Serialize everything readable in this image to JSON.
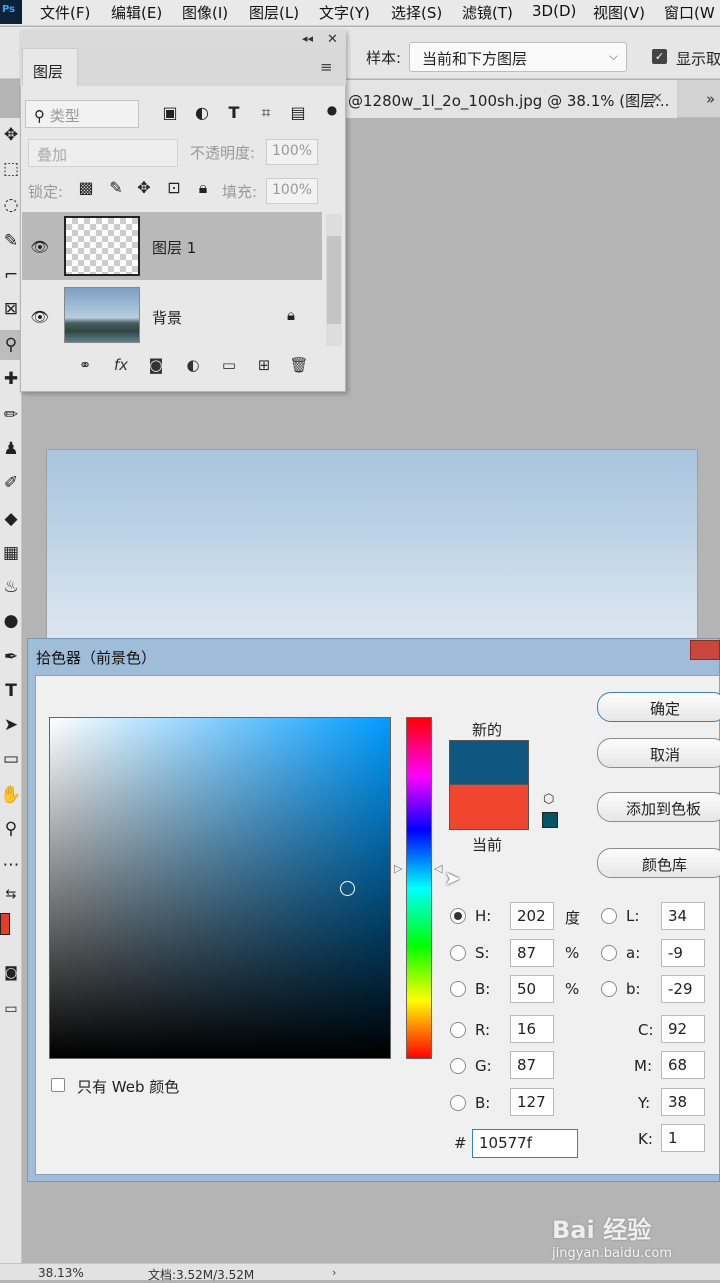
{
  "menubar": {
    "logo": "Ps",
    "items": [
      "文件(F)",
      "编辑(E)",
      "图像(I)",
      "图层(L)",
      "文字(Y)",
      "选择(S)",
      "滤镜(T)",
      "3D(D)",
      "视图(V)",
      "窗口(W"
    ]
  },
  "options": {
    "sample_label": "样本:",
    "sample_value": "当前和下方图层",
    "show_ring_label": "显示取"
  },
  "document": {
    "tab_title": "@1280w_1l_2o_100sh.jpg @ 38.1% (图层...",
    "tab_close": "×",
    "tab_more": "»"
  },
  "layers_panel": {
    "tab": "图层",
    "filter_label": "类型",
    "blend_mode": "叠加",
    "opacity_label": "不透明度:",
    "opacity_value": "100%",
    "lock_label": "锁定:",
    "fill_label": "填充:",
    "fill_value": "100%",
    "layers": [
      {
        "name": "图层 1",
        "visible": true,
        "selected": true
      },
      {
        "name": "背景",
        "visible": true,
        "locked": true
      }
    ]
  },
  "color_picker": {
    "title": "拾色器（前景色）",
    "new_label": "新的",
    "current_label": "当前",
    "new_color": "#10577f",
    "current_color": "#f0452e",
    "buttons": {
      "ok": "确定",
      "cancel": "取消",
      "add_to_swatches": "添加到色板",
      "color_libraries": "颜色库"
    },
    "web_only_label": "只有 Web 颜色",
    "hsb": {
      "h": {
        "label": "H:",
        "value": "202",
        "unit": "度"
      },
      "s": {
        "label": "S:",
        "value": "87",
        "unit": "%"
      },
      "b": {
        "label": "B:",
        "value": "50",
        "unit": "%"
      }
    },
    "lab": {
      "l": {
        "label": "L:",
        "value": "34"
      },
      "a": {
        "label": "a:",
        "value": "-9"
      },
      "b": {
        "label": "b:",
        "value": "-29"
      }
    },
    "rgb": {
      "r": {
        "label": "R:",
        "value": "16"
      },
      "g": {
        "label": "G:",
        "value": "87"
      },
      "b": {
        "label": "B:",
        "value": "127"
      }
    },
    "cmyk": {
      "c": {
        "label": "C:",
        "value": "92"
      },
      "m": {
        "label": "M:",
        "value": "68"
      },
      "y": {
        "label": "Y:",
        "value": "38"
      },
      "k": {
        "label": "K:",
        "value": "1"
      }
    },
    "hex_label": "#",
    "hex_value": "10577f"
  },
  "foreground_color": "#e63c25",
  "status": {
    "zoom": "38.13%",
    "doc": "文档:3.52M/3.52M",
    "arrow": "›"
  },
  "watermark": {
    "brand": "Bai 经验",
    "url": "jingyan.baidu.com"
  }
}
